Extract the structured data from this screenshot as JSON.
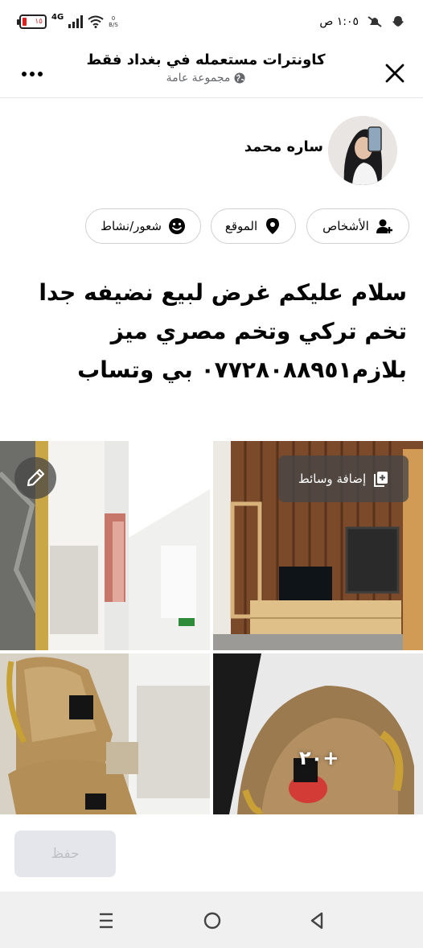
{
  "status_bar": {
    "time": "١:٠٥ ص",
    "battery_level": "١٥",
    "network": "4G",
    "speed": "0\nB/S"
  },
  "header": {
    "title": "كاونترات مستعمله في بغداد فقط",
    "subtitle": "مجموعة عامة"
  },
  "user": {
    "name": "ساره محمد"
  },
  "chips": {
    "people": "الأشخاص",
    "location": "الموقع",
    "feeling": "شعور/نشاط"
  },
  "post": {
    "text": "سلام عليكم غرض لبيع نضيفه جدا\nتخم تركي وتخم مصري  ميز\nبلازم٠٧٧٢٨٠٨٨٩٥١ بي  وتساب"
  },
  "media": {
    "add_media_label": "إضافة وسائط",
    "more_count": "+٢٠"
  },
  "actions": {
    "save_label": "حفظ"
  },
  "colors": {
    "text": "#050505",
    "secondary_text": "#65676b",
    "border": "#ced0d4",
    "save_bg": "#e4e6eb",
    "save_text": "#bcc0c4"
  }
}
